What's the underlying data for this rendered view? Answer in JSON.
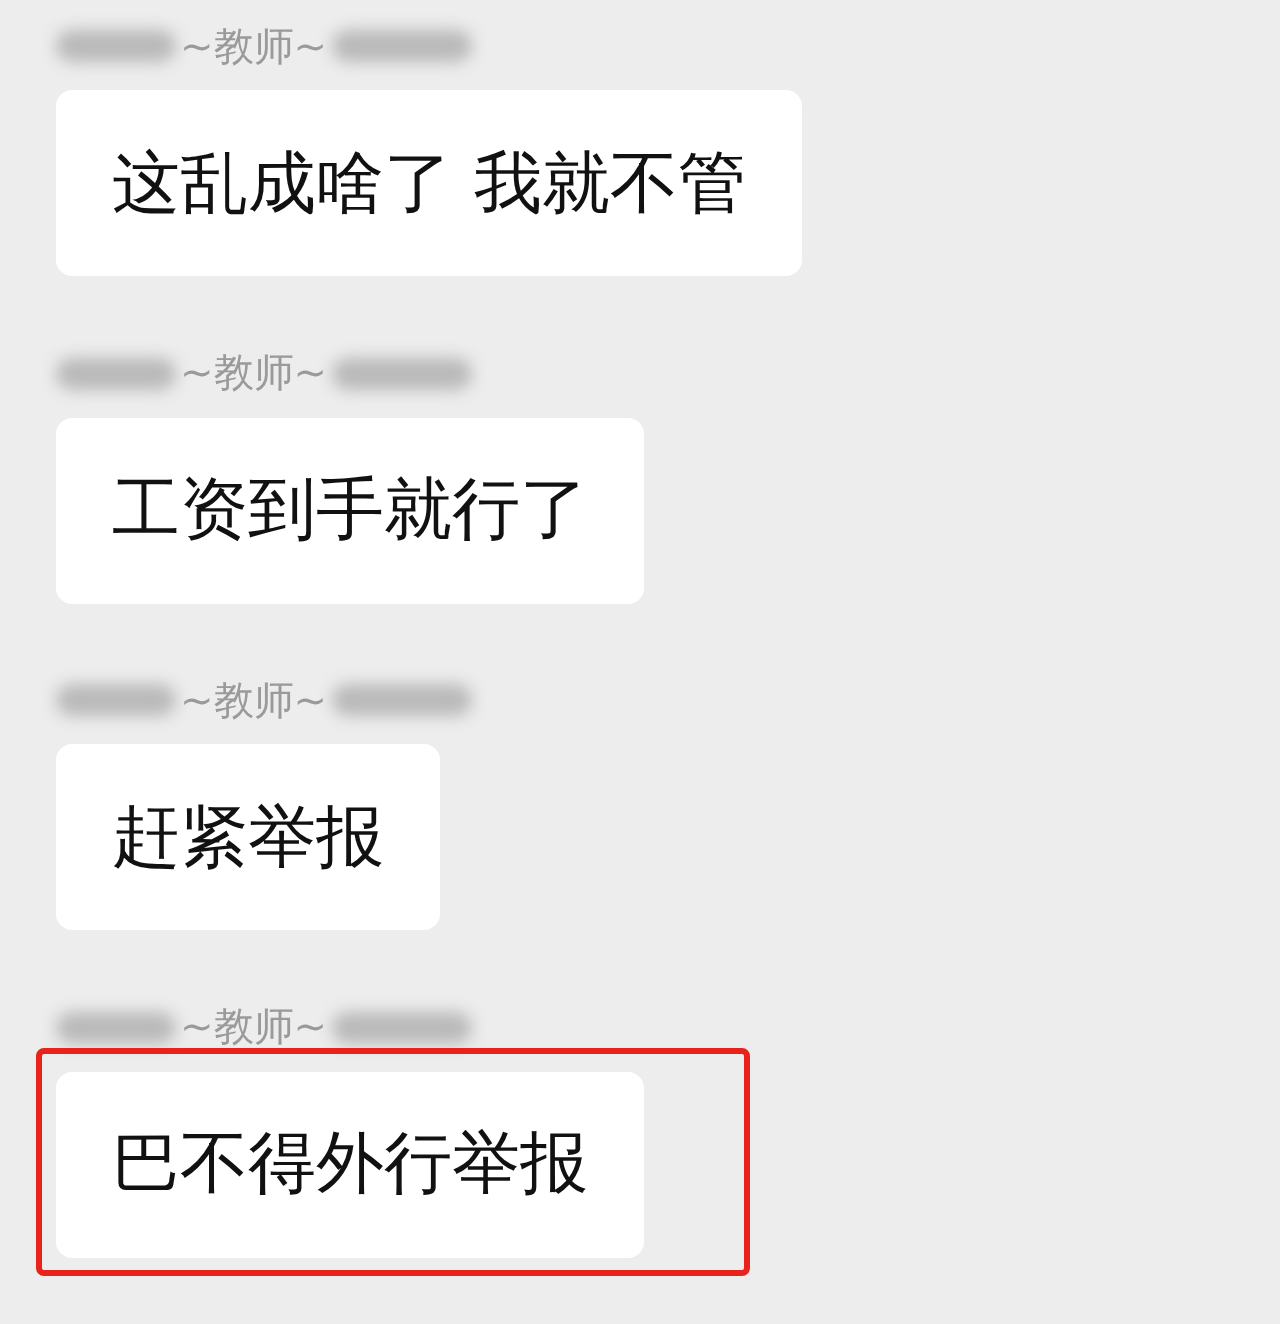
{
  "messages": [
    {
      "sender": "~教师~",
      "text": "这乱成啥了 我就不管",
      "highlighted": false
    },
    {
      "sender": "~教师~",
      "text": "工资到手就行了",
      "highlighted": false
    },
    {
      "sender": "~教师~",
      "text": "赶紧举报",
      "highlighted": false
    },
    {
      "sender": "~教师~",
      "text": "巴不得外行举报",
      "highlighted": true
    }
  ]
}
